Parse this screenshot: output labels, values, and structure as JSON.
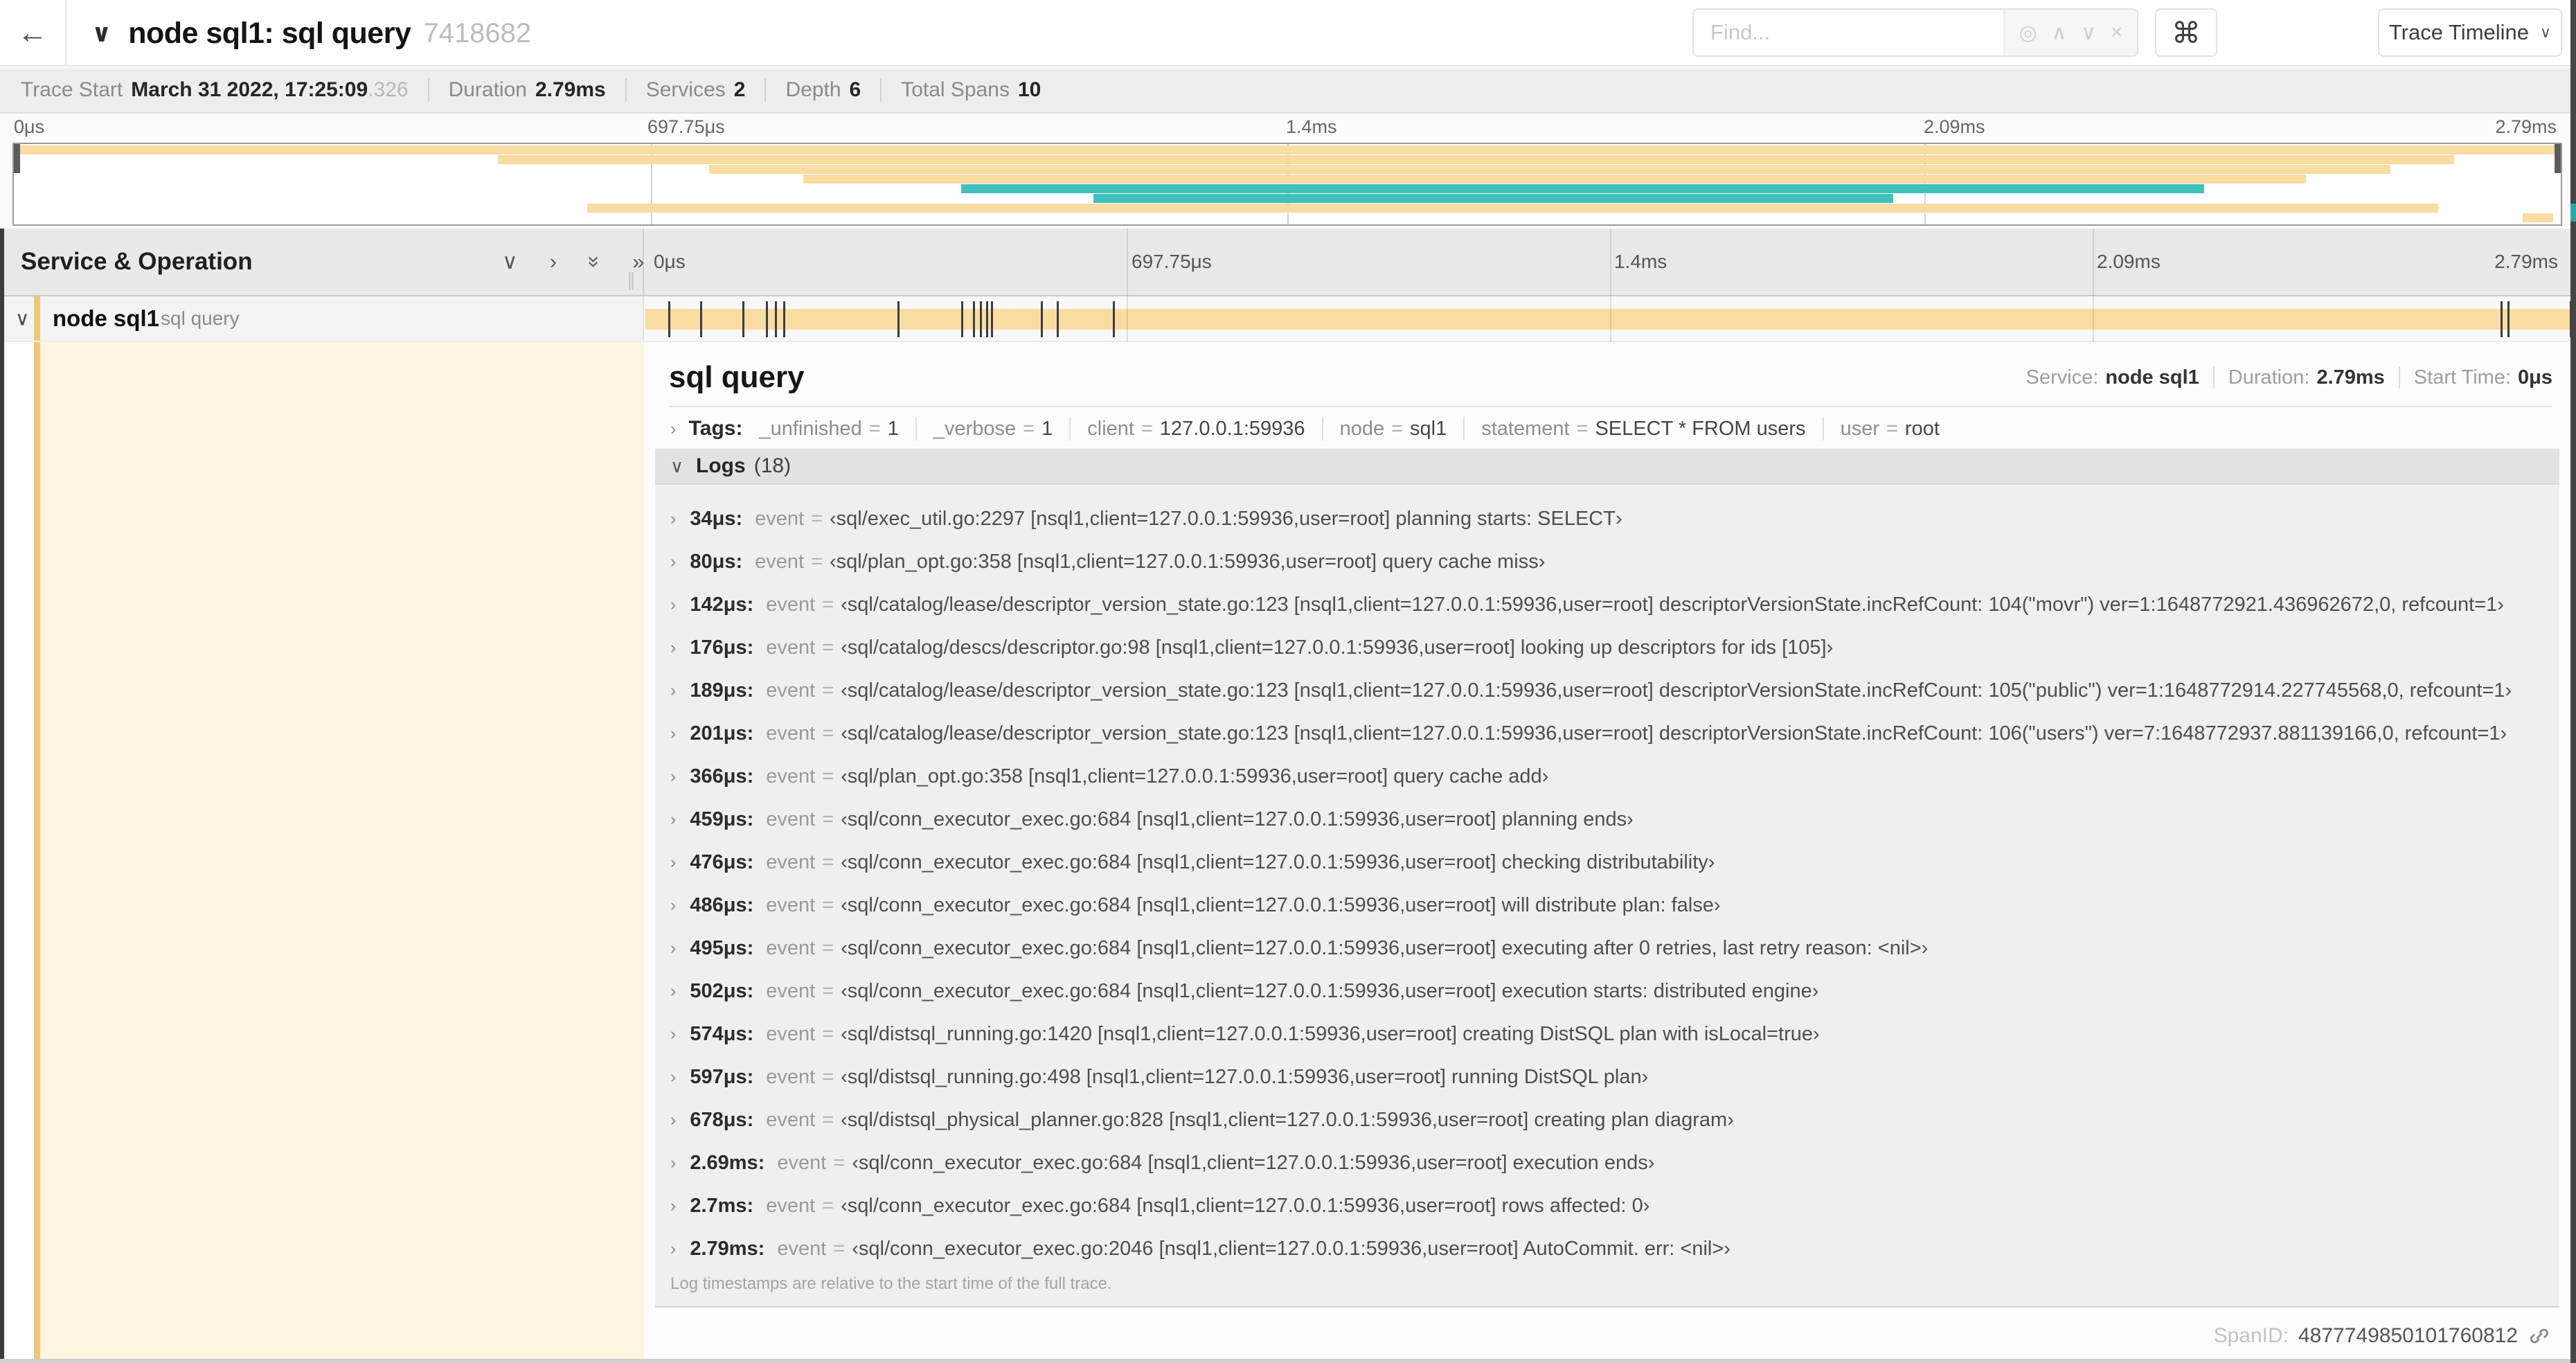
{
  "header": {
    "back_icon": "←",
    "collapse_icon": "∨",
    "title": "node sql1: sql query",
    "trace_id": "7418682",
    "find_placeholder": "Find...",
    "find_icons": {
      "locate": "◎",
      "prev": "∧",
      "next": "∨",
      "clear": "×"
    },
    "shortcut_key": "⌘",
    "view_dropdown": {
      "label": "Trace Timeline",
      "caret": "∨"
    }
  },
  "summary": {
    "items": [
      {
        "label": "Trace Start",
        "value": "March 31 2022, 17:25:09",
        "suffix": ".326"
      },
      {
        "label": "Duration",
        "value": "2.79ms"
      },
      {
        "label": "Services",
        "value": "2"
      },
      {
        "label": "Depth",
        "value": "6"
      },
      {
        "label": "Total Spans",
        "value": "10"
      }
    ]
  },
  "minimap": {
    "ticks": [
      "0μs",
      "697.75μs",
      "1.4ms",
      "2.09ms",
      "2.79ms"
    ],
    "colors": {
      "yellow": "#f8dca1",
      "teal": "#41c0bc"
    },
    "spans": [
      {
        "row": 0,
        "start": 0.0,
        "end": 1.0,
        "color": "yellow"
      },
      {
        "row": 1,
        "start": 0.19,
        "end": 0.958,
        "color": "yellow"
      },
      {
        "row": 2,
        "start": 0.273,
        "end": 0.933,
        "color": "yellow"
      },
      {
        "row": 3,
        "start": 0.31,
        "end": 0.9,
        "color": "yellow"
      },
      {
        "row": 4,
        "start": 0.372,
        "end": 0.86,
        "color": "teal"
      },
      {
        "row": 5,
        "start": 0.424,
        "end": 0.738,
        "color": "teal"
      },
      {
        "row": 6,
        "start": 0.225,
        "end": 0.952,
        "color": "yellow"
      },
      {
        "row": 7,
        "start": 0.985,
        "end": 0.997,
        "color": "yellow"
      }
    ]
  },
  "timeline": {
    "header_title": "Service & Operation",
    "controls": {
      "collapse_one": "∨",
      "expand_one": "›",
      "collapse_all": "»",
      "expand_all": "»",
      "grip": "∥"
    },
    "ticks": [
      "0μs",
      "697.75μs",
      "1.4ms",
      "2.09ms",
      "2.79ms"
    ],
    "span": {
      "caret": "∨",
      "service": "node sql1",
      "operation": "sql query"
    }
  },
  "detail": {
    "title": "sql query",
    "overview": [
      {
        "label": "Service:",
        "value": "node sql1"
      },
      {
        "label": "Duration:",
        "value": "2.79ms"
      },
      {
        "label": "Start Time:",
        "value": "0μs"
      }
    ],
    "tags": {
      "chevron": "›",
      "label": "Tags:",
      "eq": "=",
      "items": [
        {
          "key": "_unfinished",
          "value": "1"
        },
        {
          "key": "_verbose",
          "value": "1"
        },
        {
          "key": "client",
          "value": "127.0.0.1:59936"
        },
        {
          "key": "node",
          "value": "sql1"
        },
        {
          "key": "statement",
          "value": "SELECT * FROM users"
        },
        {
          "key": "user",
          "value": "root"
        }
      ]
    },
    "logs": {
      "chevron": "∨",
      "label": "Logs",
      "count": "(18)",
      "row_chevron": "›",
      "eq": "=",
      "trace_duration_us": 2790,
      "entries": [
        {
          "time": "34μs:",
          "us": 34,
          "field": "event",
          "value": "‹sql/exec_util.go:2297 [nsql1,client=127.0.0.1:59936,user=root] planning starts: SELECT›"
        },
        {
          "time": "80μs:",
          "us": 80,
          "field": "event",
          "value": "‹sql/plan_opt.go:358 [nsql1,client=127.0.0.1:59936,user=root] query cache miss›"
        },
        {
          "time": "142μs:",
          "us": 142,
          "field": "event",
          "value": "‹sql/catalog/lease/descriptor_version_state.go:123 [nsql1,client=127.0.0.1:59936,user=root] descriptorVersionState.incRefCount: 104(\"movr\") ver=1:1648772921.436962672,0, refcount=1›"
        },
        {
          "time": "176μs:",
          "us": 176,
          "field": "event",
          "value": "‹sql/catalog/descs/descriptor.go:98 [nsql1,client=127.0.0.1:59936,user=root] looking up descriptors for ids [105]›"
        },
        {
          "time": "189μs:",
          "us": 189,
          "field": "event",
          "value": "‹sql/catalog/lease/descriptor_version_state.go:123 [nsql1,client=127.0.0.1:59936,user=root] descriptorVersionState.incRefCount: 105(\"public\") ver=1:1648772914.227745568,0, refcount=1›"
        },
        {
          "time": "201μs:",
          "us": 201,
          "field": "event",
          "value": "‹sql/catalog/lease/descriptor_version_state.go:123 [nsql1,client=127.0.0.1:59936,user=root] descriptorVersionState.incRefCount: 106(\"users\") ver=7:1648772937.881139166,0, refcount=1›"
        },
        {
          "time": "366μs:",
          "us": 366,
          "field": "event",
          "value": "‹sql/plan_opt.go:358 [nsql1,client=127.0.0.1:59936,user=root] query cache add›"
        },
        {
          "time": "459μs:",
          "us": 459,
          "field": "event",
          "value": "‹sql/conn_executor_exec.go:684 [nsql1,client=127.0.0.1:59936,user=root] planning ends›"
        },
        {
          "time": "476μs:",
          "us": 476,
          "field": "event",
          "value": "‹sql/conn_executor_exec.go:684 [nsql1,client=127.0.0.1:59936,user=root] checking distributability›"
        },
        {
          "time": "486μs:",
          "us": 486,
          "field": "event",
          "value": "‹sql/conn_executor_exec.go:684 [nsql1,client=127.0.0.1:59936,user=root] will distribute plan: false›"
        },
        {
          "time": "495μs:",
          "us": 495,
          "field": "event",
          "value": "‹sql/conn_executor_exec.go:684 [nsql1,client=127.0.0.1:59936,user=root] executing after 0 retries, last retry reason: <nil>›"
        },
        {
          "time": "502μs:",
          "us": 502,
          "field": "event",
          "value": "‹sql/conn_executor_exec.go:684 [nsql1,client=127.0.0.1:59936,user=root] execution starts: distributed engine›"
        },
        {
          "time": "574μs:",
          "us": 574,
          "field": "event",
          "value": "‹sql/distsql_running.go:1420 [nsql1,client=127.0.0.1:59936,user=root] creating DistSQL plan with isLocal=true›"
        },
        {
          "time": "597μs:",
          "us": 597,
          "field": "event",
          "value": "‹sql/distsql_running.go:498 [nsql1,client=127.0.0.1:59936,user=root] running DistSQL plan›"
        },
        {
          "time": "678μs:",
          "us": 678,
          "field": "event",
          "value": "‹sql/distsql_physical_planner.go:828 [nsql1,client=127.0.0.1:59936,user=root] creating plan diagram›"
        },
        {
          "time": "2.69ms:",
          "us": 2690,
          "field": "event",
          "value": "‹sql/conn_executor_exec.go:684 [nsql1,client=127.0.0.1:59936,user=root] execution ends›"
        },
        {
          "time": "2.7ms:",
          "us": 2700,
          "field": "event",
          "value": "‹sql/conn_executor_exec.go:684 [nsql1,client=127.0.0.1:59936,user=root] rows affected: 0›"
        },
        {
          "time": "2.79ms:",
          "us": 2790,
          "field": "event",
          "value": "‹sql/conn_executor_exec.go:2046 [nsql1,client=127.0.0.1:59936,user=root] AutoCommit. err: <nil>›"
        }
      ],
      "footer": "Log timestamps are relative to the start time of the full trace."
    },
    "footer": {
      "spanid_label": "SpanID:",
      "spanid": "4877749850101760812"
    }
  }
}
